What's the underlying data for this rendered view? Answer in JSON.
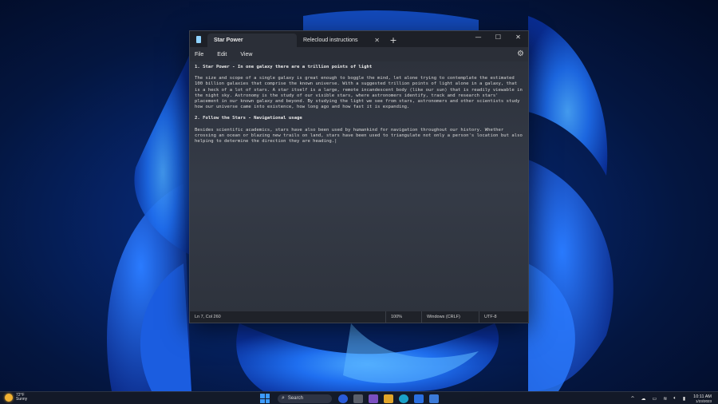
{
  "window": {
    "tabs": [
      {
        "label": "Star Power",
        "active": true
      },
      {
        "label": "Relecloud instructions",
        "active": false
      }
    ],
    "controls": {
      "minimize": "—",
      "maximize": "☐",
      "close": "✕"
    },
    "new_tab": "+",
    "tab_close": "✕"
  },
  "menu": {
    "items": [
      "File",
      "Edit",
      "View"
    ],
    "settings_icon": "⚙"
  },
  "editor": {
    "paragraphs": [
      "1. Star Power - In one galaxy there are a trillion points of light",
      "The size and scope of a single galaxy is great enough to boggle the mind, let alone trying to contemplate the estimated 100 billion galaxies that comprise the known universe. With a suggested trillion points of light alone in a galaxy, that is a heck of a lot of stars. A star itself is a large, remote incandescent body (like our sun) that is readily viewable in the night sky. Astronomy is the study of our visible stars, where astronomers identify, track and research stars' placement in our known galaxy and beyond. By studying the light we see from stars, astronomers and other scientists study how our universe came into existence, how long ago and how fast it is expanding.",
      "2. Follow the Stars - Navigational usage",
      "Besides scientific academics, stars have also been used by humankind for navigation throughout our history. Whether crossing an ocean or blazing new trails on land, stars have been used to triangulate not only a person's location but also helping to determine the direction they are heading.|"
    ]
  },
  "statusbar": {
    "position": "Ln 7, Col 260",
    "zoom": "100%",
    "line_endings": "Windows (CRLF)",
    "encoding": "UTF-8"
  },
  "taskbar": {
    "weather_temp": "72°F",
    "weather_desc": "Sunny",
    "search_placeholder": "Search",
    "time": "10:11 AM",
    "date": "1/23/2023",
    "colors": {
      "accent": "#3d9bff",
      "sun": "#f2b233"
    }
  }
}
